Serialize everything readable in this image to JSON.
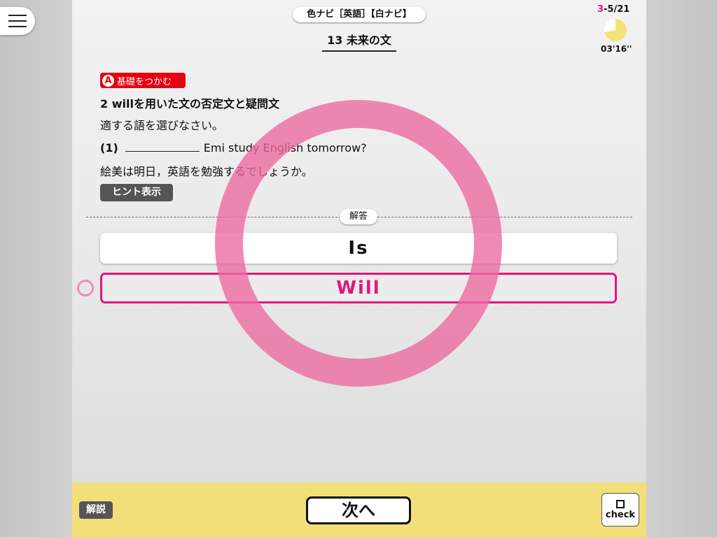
{
  "header": {
    "book_title": "色ナビ［英語］【白ナビ】",
    "chapter_title": "13 未来の文"
  },
  "progress": {
    "current": "3",
    "separator": "-",
    "rest": "5/21",
    "timer": "03'16''",
    "timer_fraction": 0.72,
    "timer_color": "#f5e27a"
  },
  "question": {
    "section_badge_letter": "A",
    "section_badge_label": "基礎をつかむ",
    "heading": "2  willを用いた文の否定文と疑問文",
    "instruction": "適する語を選びなさい。",
    "number": "(1)",
    "sentence": "Emi study English tomorrow?",
    "translation": "絵美は明日，英語を勉強するでしょうか。",
    "hint_button": "ヒント表示"
  },
  "answer": {
    "label": "解答",
    "choices": [
      {
        "text": "Is",
        "selected": false
      },
      {
        "text": "Will",
        "selected": true
      }
    ],
    "result": "correct",
    "accent_color": "#e5157c"
  },
  "footer": {
    "explain_button": "解説",
    "next_button": "次へ",
    "check_label": "check"
  }
}
